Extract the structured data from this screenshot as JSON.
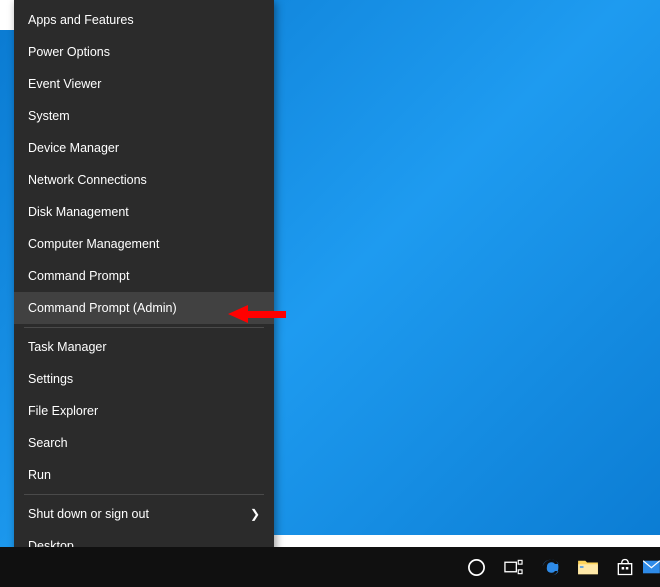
{
  "menu": {
    "section1": [
      {
        "label": "Apps and Features"
      },
      {
        "label": "Power Options"
      },
      {
        "label": "Event Viewer"
      },
      {
        "label": "System"
      },
      {
        "label": "Device Manager"
      },
      {
        "label": "Network Connections"
      },
      {
        "label": "Disk Management"
      },
      {
        "label": "Computer Management"
      },
      {
        "label": "Command Prompt"
      },
      {
        "label": "Command Prompt (Admin)",
        "highlighted": true
      }
    ],
    "section2": [
      {
        "label": "Task Manager"
      },
      {
        "label": "Settings"
      },
      {
        "label": "File Explorer"
      },
      {
        "label": "Search"
      },
      {
        "label": "Run"
      }
    ],
    "section3": [
      {
        "label": "Shut down or sign out",
        "submenu": true
      },
      {
        "label": "Desktop"
      }
    ]
  },
  "taskbar": {
    "icons": [
      {
        "name": "cortana-icon"
      },
      {
        "name": "task-view-icon"
      },
      {
        "name": "edge-icon"
      },
      {
        "name": "file-explorer-icon"
      },
      {
        "name": "store-icon"
      },
      {
        "name": "mail-icon"
      }
    ]
  }
}
